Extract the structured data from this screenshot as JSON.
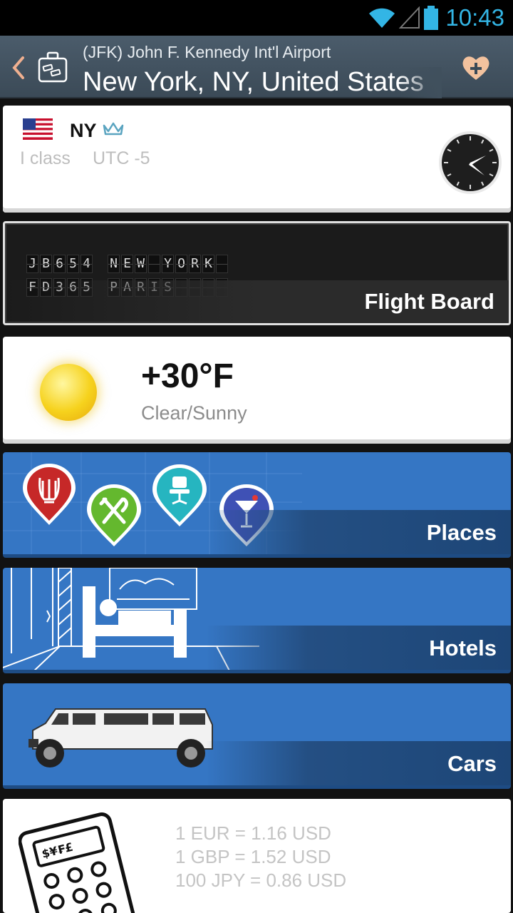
{
  "status_bar": {
    "time": "10:43",
    "icons": [
      "wifi-icon",
      "signal-icon",
      "battery-icon"
    ],
    "accent": "#33b5e5"
  },
  "header": {
    "subtitle": "(JFK) John F. Kennedy Int'l Airport",
    "title": "New York, NY, United States"
  },
  "info": {
    "code": "NY",
    "class": "I class",
    "utc": "UTC -5"
  },
  "flight_board": {
    "rows": [
      {
        "flight": "JB654",
        "dest": "NEW YORK"
      },
      {
        "flight": "FD365",
        "dest": "PARIS"
      }
    ],
    "label": "Flight Board"
  },
  "weather": {
    "temp": "+30°F",
    "condition": "Clear/Sunny"
  },
  "places": {
    "label": "Places"
  },
  "hotels": {
    "label": "Hotels"
  },
  "cars": {
    "label": "Cars"
  },
  "currency": {
    "rates": [
      "1 EUR = 1.16 USD",
      "1 GBP = 1.52 USD",
      "100 JPY = 0.86 USD"
    ],
    "calc_symbols": "$¥₣£"
  },
  "colors": {
    "actionbar": "#44535f",
    "card_blue": "#3576c4",
    "band_blue": "#1d4677"
  }
}
